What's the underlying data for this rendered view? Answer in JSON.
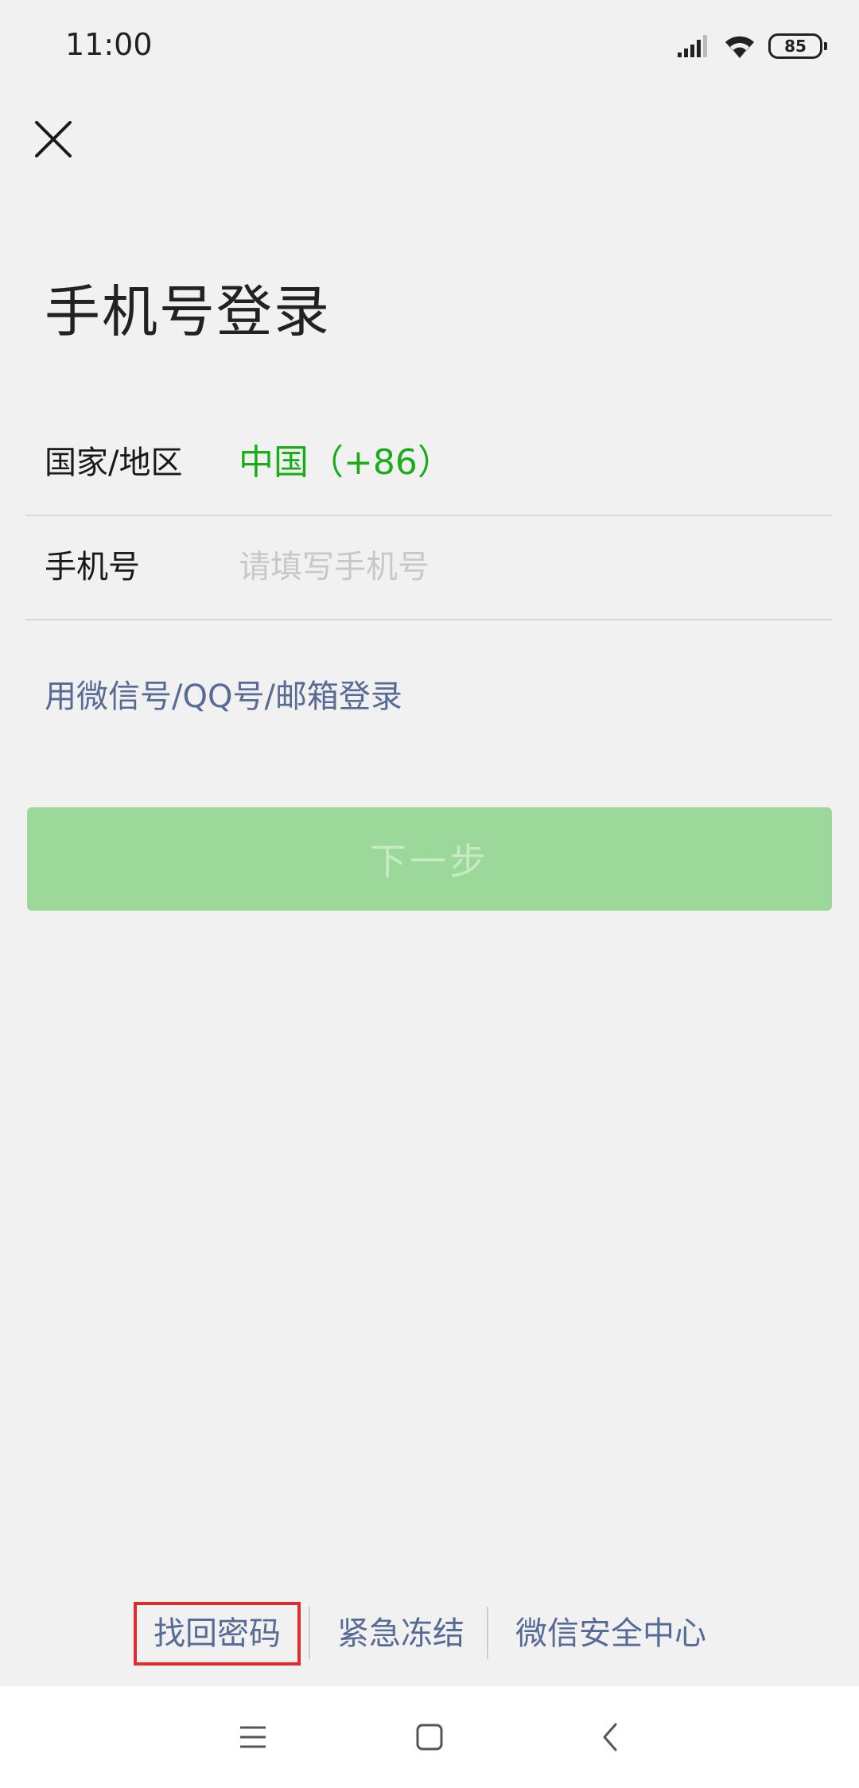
{
  "status_bar": {
    "time": "11:00",
    "battery": "85",
    "icons": [
      "signal-icon",
      "wifi-icon",
      "battery-icon"
    ]
  },
  "header": {
    "close_icon": "close-icon"
  },
  "title": "手机号登录",
  "form": {
    "country_label": "国家/地区",
    "country_value": "中国（+86）",
    "phone_label": "手机号",
    "phone_placeholder": "请填写手机号",
    "phone_value": ""
  },
  "alt_login": "用微信号/QQ号/邮箱登录",
  "next_button": "下一步",
  "footer": {
    "recover_password": "找回密码",
    "emergency_freeze": "紧急冻结",
    "security_center": "微信安全中心"
  },
  "nav_bar": {
    "icons": [
      "menu-icon",
      "home-icon",
      "back-icon"
    ]
  },
  "colors": {
    "accent_green": "#1aad19",
    "link_blue": "#576b95",
    "button_disabled": "#9cd899",
    "highlight_red": "#e02c2c",
    "background": "#f1f1f1"
  }
}
